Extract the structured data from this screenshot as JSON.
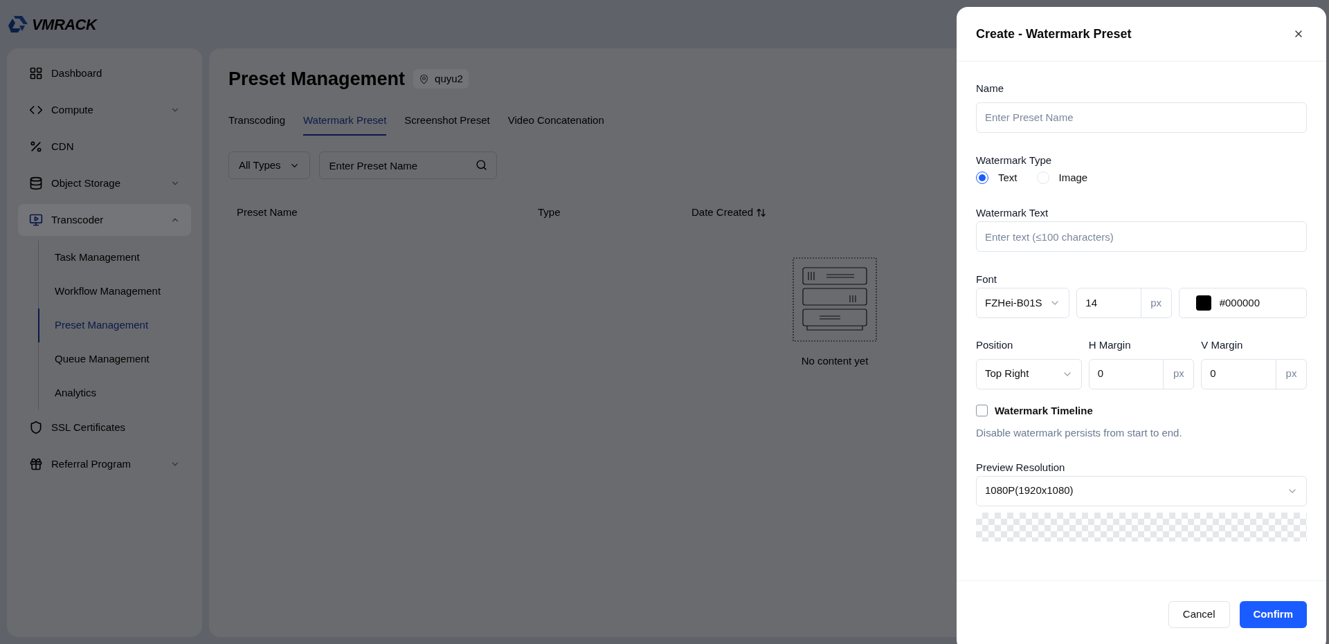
{
  "logo": {
    "text": "VMRACK"
  },
  "sidebar": {
    "items": [
      {
        "kind": "link",
        "label": "Dashboard"
      },
      {
        "kind": "group",
        "label": "Compute",
        "expanded": false
      },
      {
        "kind": "link",
        "label": "CDN"
      },
      {
        "kind": "group",
        "label": "Object Storage",
        "expanded": false
      },
      {
        "kind": "group",
        "label": "Transcoder",
        "expanded": true,
        "children": [
          {
            "label": "Task Management",
            "selected": false
          },
          {
            "label": "Workflow Management",
            "selected": false
          },
          {
            "label": "Preset Management",
            "selected": true
          },
          {
            "label": "Queue Management",
            "selected": false
          },
          {
            "label": "Analytics",
            "selected": false
          }
        ]
      },
      {
        "kind": "link",
        "label": "SSL Certificates"
      },
      {
        "kind": "group",
        "label": "Referral Program",
        "expanded": false
      }
    ]
  },
  "page": {
    "title": "Preset Management",
    "region": "quyu2",
    "tabs": [
      {
        "label": "Transcoding",
        "selected": false
      },
      {
        "label": "Watermark Preset",
        "selected": true
      },
      {
        "label": "Screenshot Preset",
        "selected": false
      },
      {
        "label": "Video Concatenation",
        "selected": false
      }
    ],
    "type_filter": "All Types",
    "search": {
      "placeholder": "Enter Preset Name"
    },
    "table": {
      "columns": [
        {
          "label": "Preset Name",
          "sortable": false
        },
        {
          "label": "Type",
          "sortable": false
        },
        {
          "label": "Date Created",
          "sortable": true
        }
      ],
      "empty_text": "No content yet"
    }
  },
  "dialog": {
    "title": "Create - Watermark Preset",
    "name": {
      "label": "Name",
      "placeholder": "Enter Preset Name"
    },
    "watermark_type": {
      "label": "Watermark Type",
      "options": [
        {
          "label": "Text",
          "selected": true
        },
        {
          "label": "Image",
          "selected": false
        }
      ]
    },
    "watermark_text": {
      "label": "Watermark Text",
      "placeholder": "Enter text (≤100 characters)"
    },
    "font": {
      "label": "Font",
      "family": "FZHei-B01S",
      "size": "14",
      "size_unit": "px",
      "color_value": "#000000"
    },
    "position": {
      "label": "Position",
      "value": "Top Right"
    },
    "h_margin": {
      "label": "H Margin",
      "value": "0",
      "unit": "px"
    },
    "v_margin": {
      "label": "V Margin",
      "value": "0",
      "unit": "px"
    },
    "timeline": {
      "label": "Watermark Timeline",
      "checked": false,
      "hint": "Disable watermark persists from start to end."
    },
    "preview": {
      "label": "Preview Resolution",
      "value": "1080P(1920x1080)"
    },
    "buttons": [
      {
        "label": "Cancel",
        "kind": "secondary"
      },
      {
        "label": "Confirm",
        "kind": "primary"
      }
    ]
  }
}
